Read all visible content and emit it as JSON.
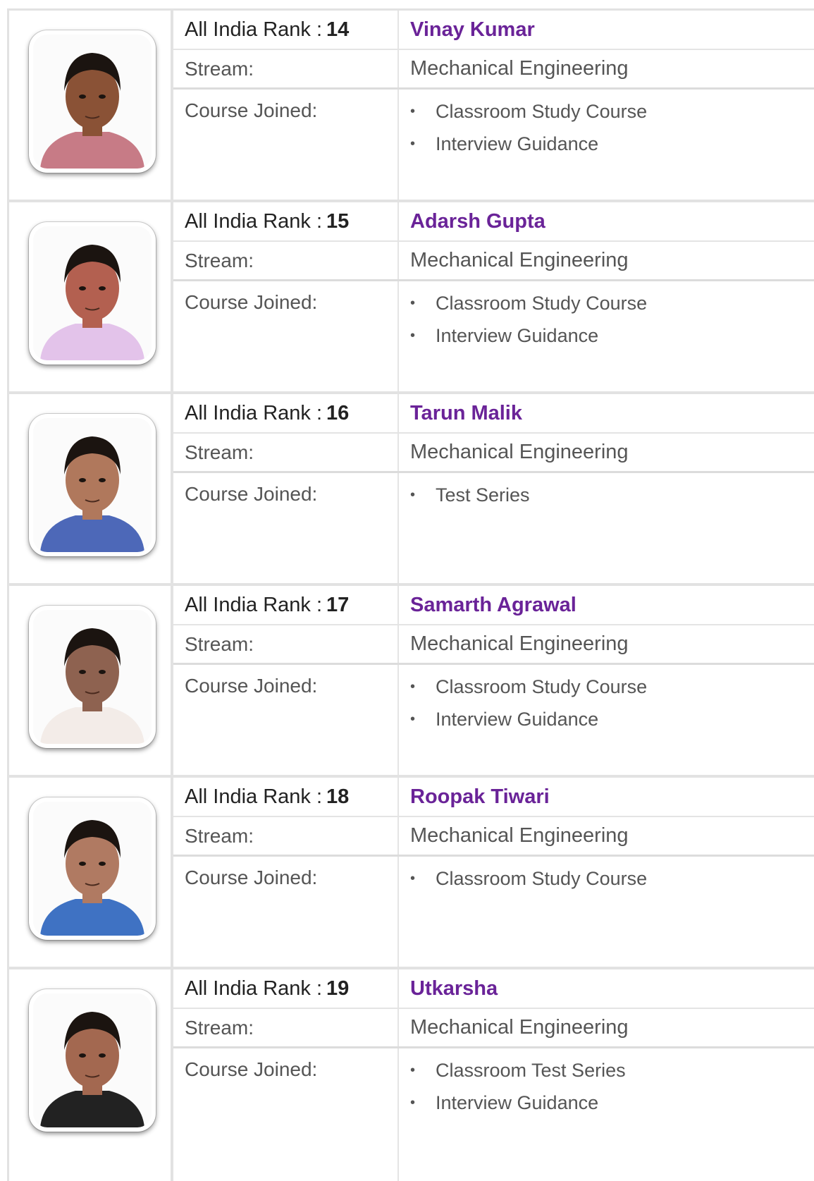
{
  "labels": {
    "rank_prefix": "All India Rank :",
    "stream": "Stream:",
    "course": "Course Joined:"
  },
  "toppers": [
    {
      "rank": "14",
      "name": "Vinay Kumar",
      "stream": "Mechanical Engineering",
      "courses": [
        "Classroom Study Course",
        "Interview Guidance"
      ],
      "shirt_color": "#c77b86",
      "skin_color": "#8a5236"
    },
    {
      "rank": "15",
      "name": "Adarsh Gupta",
      "stream": "Mechanical Engineering",
      "courses": [
        "Classroom Study Course",
        "Interview Guidance"
      ],
      "shirt_color": "#e3c3ea",
      "skin_color": "#b36050"
    },
    {
      "rank": "16",
      "name": "Tarun Malik",
      "stream": "Mechanical Engineering",
      "courses": [
        "Test Series"
      ],
      "shirt_color": "#4d68b8",
      "skin_color": "#b0785c"
    },
    {
      "rank": "17",
      "name": "Samarth Agrawal",
      "stream": "Mechanical Engineering",
      "courses": [
        "Classroom Study Course",
        "Interview Guidance"
      ],
      "shirt_color": "#f3ece8",
      "skin_color": "#8e6250"
    },
    {
      "rank": "18",
      "name": "Roopak Tiwari",
      "stream": "Mechanical Engineering",
      "courses": [
        "Classroom Study Course"
      ],
      "shirt_color": "#3f72c3",
      "skin_color": "#b07a62"
    },
    {
      "rank": "19",
      "name": "Utkarsha",
      "stream": "Mechanical Engineering",
      "courses": [
        "Classroom Test Series",
        "Interview Guidance"
      ],
      "shirt_color": "#222222",
      "skin_color": "#a36850"
    }
  ]
}
